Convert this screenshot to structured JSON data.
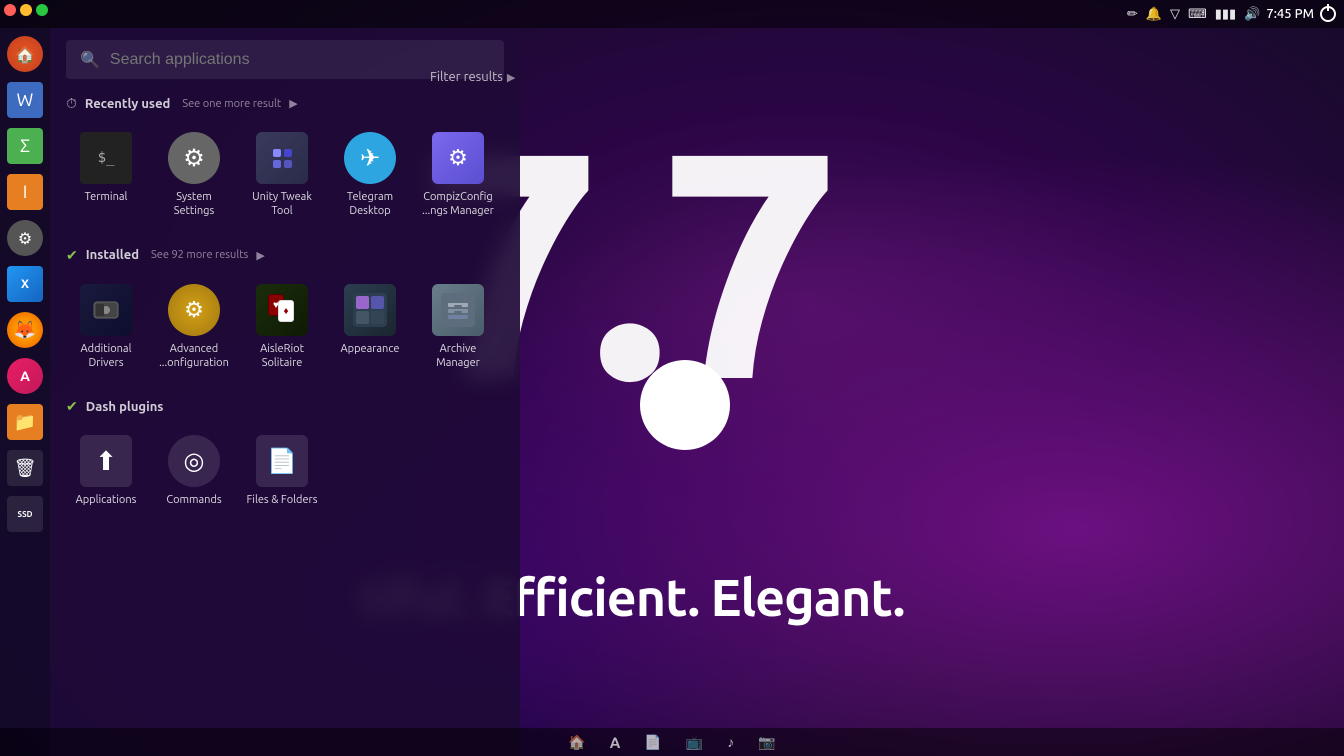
{
  "desktop": {
    "big_number": "7.7",
    "tagline": "tiful. Efficient. Elegant."
  },
  "topbar": {
    "time": "7:45 PM",
    "icons": [
      "edit-icon",
      "bell-icon",
      "wifi-icon",
      "keyboard-icon",
      "battery-icon",
      "battery-low-icon",
      "volume-icon"
    ],
    "power_label": "⏻"
  },
  "window_controls": {
    "close": "✕",
    "minimize": "−",
    "maximize": "⬜"
  },
  "search": {
    "placeholder": "Search applications",
    "filter_label": "Filter results",
    "filter_arrow": "▶"
  },
  "recently_used": {
    "section_title": "Recently used",
    "more_label": "See one more result",
    "more_arrow": "▶",
    "apps": [
      {
        "name": "Terminal",
        "icon_type": "terminal",
        "icon_char": "⬛",
        "icon_style": "ai-terminal"
      },
      {
        "name": "System Settings",
        "icon_type": "system",
        "icon_char": "⚙",
        "icon_style": "ai-system"
      },
      {
        "name": "Unity Tweak Tool",
        "icon_type": "unity",
        "icon_char": "🔧",
        "icon_style": "ai-unity"
      },
      {
        "name": "Telegram Desktop",
        "icon_type": "telegram",
        "icon_char": "✈",
        "icon_style": "ai-telegram"
      },
      {
        "name": "CompizConfig ...ngs Manager",
        "icon_type": "compiz",
        "icon_char": "🔩",
        "icon_style": "ai-compiz"
      }
    ]
  },
  "installed": {
    "section_title": "Installed",
    "more_label": "See 92 more results",
    "more_arrow": "▶",
    "apps": [
      {
        "name": "Additional Drivers",
        "icon_type": "additional",
        "icon_char": "📦",
        "icon_style": "ai-additional"
      },
      {
        "name": "Advanced ...onfiguration",
        "icon_type": "advanced",
        "icon_char": "⚙",
        "icon_style": "ai-advanced"
      },
      {
        "name": "AisleRiot Solitaire",
        "icon_type": "aisleriot",
        "icon_char": "🃏",
        "icon_style": "ai-aisleriot"
      },
      {
        "name": "Appearance",
        "icon_type": "appearance",
        "icon_char": "🎨",
        "icon_style": "ai-appearance"
      },
      {
        "name": "Archive Manager",
        "icon_type": "archive",
        "icon_char": "📦",
        "icon_style": "ai-archive"
      }
    ]
  },
  "dash_plugins": {
    "section_title": "Dash plugins",
    "apps": [
      {
        "name": "Applications",
        "icon_type": "apps",
        "icon_char": "⬆",
        "icon_style": "ai-apps"
      },
      {
        "name": "Commands",
        "icon_type": "commands",
        "icon_char": "◎",
        "icon_style": "ai-commands"
      },
      {
        "name": "Files & Folders",
        "icon_type": "files",
        "icon_char": "📄",
        "icon_style": "ai-files"
      }
    ]
  },
  "sidebar": {
    "items": [
      {
        "name": "ubuntu-home",
        "icon_char": "🏠",
        "color": "#e95420",
        "type": "ubuntu"
      },
      {
        "name": "libreoffice-writer",
        "icon_char": "W",
        "color": "#3d6bbf",
        "type": "writer"
      },
      {
        "name": "libreoffice-calc",
        "icon_char": "C",
        "color": "#4caf50",
        "type": "calc"
      },
      {
        "name": "libreoffice-impress",
        "icon_char": "I",
        "color": "#e67e22",
        "type": "impress"
      },
      {
        "name": "system-settings",
        "icon_char": "⚙",
        "color": "#555",
        "type": "settings"
      },
      {
        "name": "xorg",
        "icon_char": "X",
        "color": "#2196F3",
        "type": "xorg"
      },
      {
        "name": "firefox",
        "icon_char": "🦊",
        "color": "#ff9500",
        "type": "firefox"
      },
      {
        "name": "apt-update",
        "icon_char": "A",
        "color": "#e91e63",
        "type": "apt"
      },
      {
        "name": "orange-folder",
        "icon_char": "📁",
        "color": "#e67e22",
        "type": "orange"
      },
      {
        "name": "trash",
        "icon_char": "🗑",
        "color": "transparent",
        "type": "trash"
      },
      {
        "name": "ssd-drive",
        "icon_char": "SSD",
        "color": "transparent",
        "type": "ssd"
      }
    ]
  },
  "taskbar": {
    "icons": [
      {
        "name": "home-icon",
        "char": "🏠"
      },
      {
        "name": "font-icon",
        "char": "A"
      },
      {
        "name": "file-icon",
        "char": "📄"
      },
      {
        "name": "screen-icon",
        "char": "📺"
      },
      {
        "name": "music-icon",
        "char": "♪"
      },
      {
        "name": "camera-icon",
        "char": "📷"
      }
    ]
  }
}
